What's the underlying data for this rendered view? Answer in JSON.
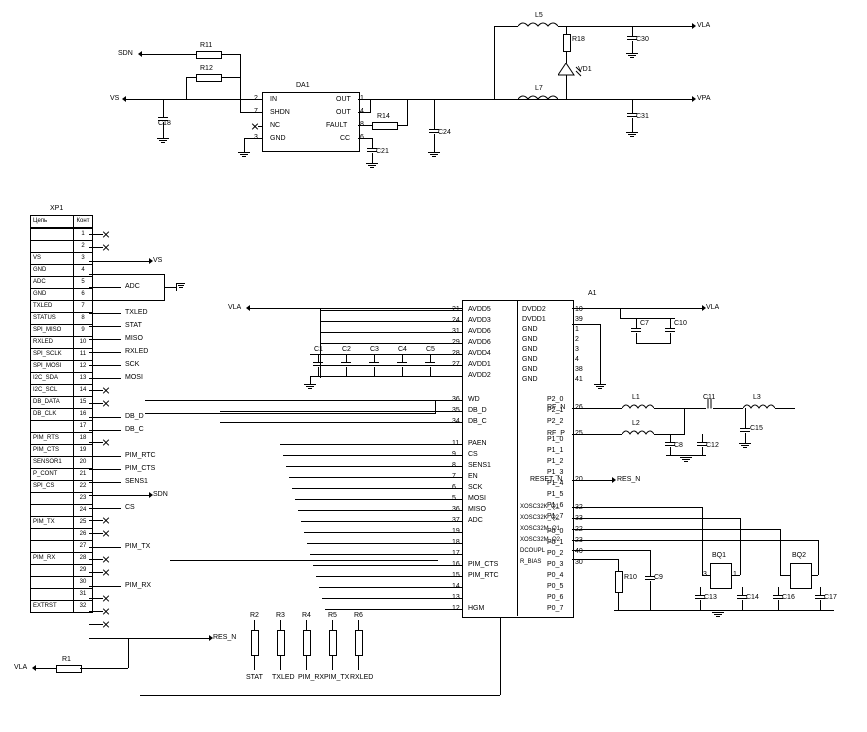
{
  "top": {
    "da1": {
      "ref": "DA1",
      "pins_left": [
        {
          "n": "2",
          "name": "IN"
        },
        {
          "n": "7",
          "name": "SHDN"
        },
        {
          "n": "",
          "name": "NC"
        },
        {
          "n": "3",
          "name": "GND"
        }
      ],
      "pins_right": [
        {
          "n": "1",
          "name": "OUT"
        },
        {
          "n": "4",
          "name": "OUT"
        },
        {
          "n": "8",
          "name": "FAULT"
        },
        {
          "n": "6",
          "name": "CC"
        }
      ]
    },
    "nets": {
      "sdn_l": "SDN",
      "vs_l": "VS",
      "vla": "VLA",
      "vpa": "VPA"
    },
    "parts": {
      "r11": "R11",
      "r12": "R12",
      "c18": "C18",
      "r14": "R14",
      "c21": "C21",
      "c24": "C24",
      "l5": "L5",
      "l7": "L7",
      "r18": "R18",
      "vd1": "VD1",
      "c30": "C30",
      "c31": "C31"
    }
  },
  "connector": {
    "ref": "XP1",
    "headers": [
      "Цепь",
      "Конт"
    ],
    "rows": [
      {
        "sig": "",
        "pin": "1"
      },
      {
        "sig": "",
        "pin": "2"
      },
      {
        "sig": "VS",
        "pin": "3"
      },
      {
        "sig": "GND",
        "pin": "4"
      },
      {
        "sig": "ADC",
        "pin": "5"
      },
      {
        "sig": "GND",
        "pin": "6"
      },
      {
        "sig": "TXLED",
        "pin": "7"
      },
      {
        "sig": "STATUS",
        "pin": "8"
      },
      {
        "sig": "SPI_MISO",
        "pin": "9"
      },
      {
        "sig": "RXLED",
        "pin": "10"
      },
      {
        "sig": "SPI_SCLK",
        "pin": "11"
      },
      {
        "sig": "SPI_MOSI",
        "pin": "12"
      },
      {
        "sig": "I2C_SDA",
        "pin": "13"
      },
      {
        "sig": "I2C_SCL",
        "pin": "14"
      },
      {
        "sig": "DB_DATA",
        "pin": "15"
      },
      {
        "sig": "DB_CLK",
        "pin": "16"
      },
      {
        "sig": "",
        "pin": "17"
      },
      {
        "sig": "PIM_RTS",
        "pin": "18"
      },
      {
        "sig": "PIM_CTS",
        "pin": "19"
      },
      {
        "sig": "SENSOR1",
        "pin": "20"
      },
      {
        "sig": "P_CONT",
        "pin": "21"
      },
      {
        "sig": "SPI_CS",
        "pin": "22"
      },
      {
        "sig": "",
        "pin": "23"
      },
      {
        "sig": "",
        "pin": "24"
      },
      {
        "sig": "PIM_TX",
        "pin": "25"
      },
      {
        "sig": "",
        "pin": "26"
      },
      {
        "sig": "",
        "pin": "27"
      },
      {
        "sig": "PIM_RX",
        "pin": "28"
      },
      {
        "sig": "",
        "pin": "29"
      },
      {
        "sig": "",
        "pin": "30"
      },
      {
        "sig": "",
        "pin": "31"
      },
      {
        "sig": "EXTRST",
        "pin": "32"
      }
    ]
  },
  "mcu": {
    "ref": "A1",
    "pins_left_upper": [
      {
        "n": "21",
        "name": "AVDD5"
      },
      {
        "n": "24",
        "name": "AVDD3"
      },
      {
        "n": "31",
        "name": "AVDD6"
      },
      {
        "n": "29",
        "name": "AVDD6"
      },
      {
        "n": "28",
        "name": "AVDD4"
      },
      {
        "n": "27",
        "name": "AVDD1"
      },
      {
        "n": "",
        "name": "AVDD2"
      }
    ],
    "pins_left_mid": [
      {
        "n": "36",
        "name": "WD"
      },
      {
        "n": "35",
        "name": "DB_D"
      },
      {
        "n": "34",
        "name": "DB_C"
      }
    ],
    "pins_left_lower": [
      {
        "n": "11",
        "name": "PAEN"
      },
      {
        "n": "9",
        "name": "CS"
      },
      {
        "n": "8",
        "name": "SENS1"
      },
      {
        "n": "7",
        "name": "EN"
      },
      {
        "n": "6",
        "name": "SCK"
      },
      {
        "n": "5",
        "name": "MOSI"
      },
      {
        "n": "36",
        "name": "MISO"
      },
      {
        "n": "37",
        "name": "ADC"
      },
      {
        "n": "19",
        "name": ""
      },
      {
        "n": "18",
        "name": ""
      },
      {
        "n": "17",
        "name": ""
      },
      {
        "n": "16",
        "name": "PIM_CTS"
      },
      {
        "n": "15",
        "name": "PIM_RTC"
      },
      {
        "n": "14",
        "name": ""
      },
      {
        "n": "13",
        "name": ""
      },
      {
        "n": "12",
        "name": "HGM"
      }
    ],
    "pins_right_upper": [
      {
        "n": "10",
        "name": "DVDD2"
      },
      {
        "n": "39",
        "name": "DVDD1"
      },
      {
        "n": "1",
        "name": "GND"
      },
      {
        "n": "2",
        "name": "GND"
      },
      {
        "n": "3",
        "name": "GND"
      },
      {
        "n": "4",
        "name": "GND"
      },
      {
        "n": "38",
        "name": "GND"
      },
      {
        "n": "41",
        "name": "GND"
      }
    ],
    "pins_right_p2": [
      {
        "n": "",
        "name": "P2_0"
      },
      {
        "n": "",
        "name": "P2_1"
      },
      {
        "n": "",
        "name": "P2_2"
      }
    ],
    "pins_right_p1": [
      {
        "n": "",
        "name": "P1_0"
      },
      {
        "n": "",
        "name": "P1_1"
      },
      {
        "n": "",
        "name": "P1_2"
      },
      {
        "n": "",
        "name": "P1_3"
      },
      {
        "n": "",
        "name": "P1_4"
      },
      {
        "n": "",
        "name": "P1_5"
      },
      {
        "n": "",
        "name": "P1_6"
      },
      {
        "n": "",
        "name": "P1_7"
      }
    ],
    "pins_right_p0": [
      {
        "n": "",
        "name": "P0_0"
      },
      {
        "n": "",
        "name": "P0_1"
      },
      {
        "n": "",
        "name": "P0_2"
      },
      {
        "n": "",
        "name": "P0_3"
      },
      {
        "n": "",
        "name": "P0_4"
      },
      {
        "n": "",
        "name": "P0_5"
      },
      {
        "n": "",
        "name": "P0_6"
      },
      {
        "n": "",
        "name": "P0_7"
      }
    ],
    "pins_rf": [
      "RF_N",
      "RF_P"
    ],
    "pins_misc": [
      "RESET_N",
      "XOSC32K_Q1",
      "XOSC32K_Q2",
      "XOSC32M_Q1",
      "XOSC32M_Q2",
      "DCOUPL",
      "R_BIAS"
    ]
  },
  "nets_mid": {
    "vla": "VLA",
    "vs": "VS",
    "sdn": "SDN",
    "res_n": "RES_N",
    "reset_out": "RES_N",
    "adc": "ADC",
    "stat": "STAT",
    "miso": "MISO",
    "rxled": "RXLED",
    "sck": "SCK",
    "mosi": "MOSI",
    "db_d": "DB_D",
    "db_c": "DB_C",
    "pim_rtc": "PIM_RTC",
    "pim_cts": "PIM_CTS",
    "sens1": "SENS1",
    "cs": "CS",
    "pim_tx": "PIM_TX",
    "pim_rx": "PIM_RX",
    "txled": "TXLED"
  },
  "parts_mid": {
    "c1": "C1",
    "c2": "C2",
    "c3": "C3",
    "c4": "C4",
    "c5": "C5",
    "c7": "C7",
    "c10": "C10",
    "l1": "L1",
    "l2": "L2",
    "l3": "L3",
    "c8": "C8",
    "c11": "C11",
    "c12": "C12",
    "c15": "C15",
    "r10": "R10",
    "c9": "C9",
    "c13": "C13",
    "c14": "C14",
    "c16": "C16",
    "c17": "C17",
    "bq1": "BQ1",
    "bq2": "BQ2",
    "r1": "R1",
    "r2": "R2",
    "r3": "R3",
    "r4": "R4",
    "r5": "R5",
    "r6": "R6"
  },
  "bottom_labels": [
    "STAT",
    "TXLED",
    "PIM_RX",
    "PIM_TX",
    "RXLED"
  ],
  "vla_bottom": "VLA"
}
